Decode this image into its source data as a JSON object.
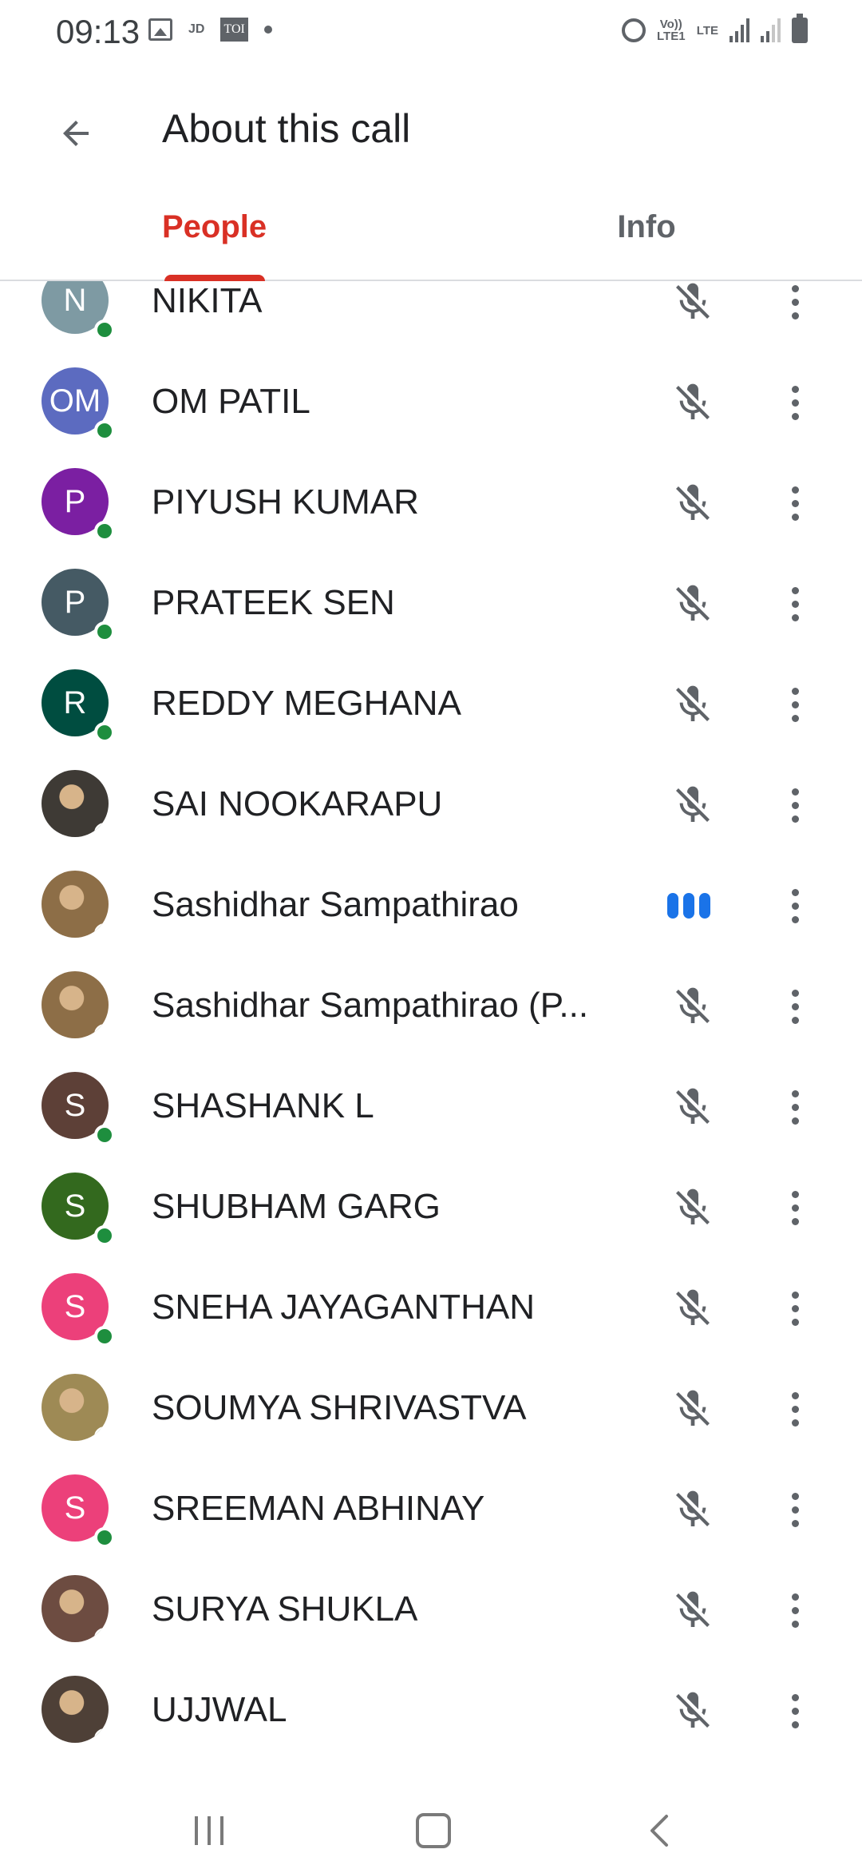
{
  "status_bar": {
    "time": "09:13",
    "left_icons": [
      "gallery-icon",
      "jd-icon",
      "toi-icon",
      "dot-icon"
    ],
    "jd_label": "JD",
    "toi_label": "TOI",
    "volte_label": "Vo)) LTE1",
    "lte_label": "LTE",
    "right_icons": [
      "alarm-icon",
      "volte-icon",
      "lte-icon",
      "signal-icon",
      "signal-icon",
      "battery-icon"
    ]
  },
  "header": {
    "title": "About this call",
    "back_icon": "arrow-back-icon"
  },
  "tabs": [
    {
      "label": "People",
      "active": true
    },
    {
      "label": "Info",
      "active": false
    }
  ],
  "colors": {
    "accent": "#d93025",
    "presence": "#1e8e3e",
    "speaking": "#1a73e8"
  },
  "participants": [
    {
      "name": "NIKITA",
      "initials": "N",
      "avatar_color": "#7e9aa3",
      "status": "muted"
    },
    {
      "name": "OM PATIL",
      "initials": "OM",
      "avatar_color": "#5c6bc0",
      "status": "muted"
    },
    {
      "name": "PIYUSH KUMAR",
      "initials": "P",
      "avatar_color": "#7b1fa2",
      "status": "muted"
    },
    {
      "name": "PRATEEK SEN",
      "initials": "P",
      "avatar_color": "#455a64",
      "status": "muted"
    },
    {
      "name": "REDDY MEGHANA",
      "initials": "R",
      "avatar_color": "#004d40",
      "status": "muted"
    },
    {
      "name": "SAI NOOKARAPU",
      "initials": "",
      "avatar_color": "#3e3a35",
      "status": "muted",
      "photo": true
    },
    {
      "name": "Sashidhar Sampathirao",
      "initials": "",
      "avatar_color": "#8d6e47",
      "status": "speaking",
      "photo": true
    },
    {
      "name": "Sashidhar Sampathirao (P...",
      "initials": "",
      "avatar_color": "#8d6e47",
      "status": "muted",
      "photo": true
    },
    {
      "name": "SHASHANK L",
      "initials": "S",
      "avatar_color": "#5d4037",
      "status": "muted"
    },
    {
      "name": "SHUBHAM GARG",
      "initials": "S",
      "avatar_color": "#33691e",
      "status": "muted"
    },
    {
      "name": "SNEHA JAYAGANTHAN",
      "initials": "S",
      "avatar_color": "#ec407a",
      "status": "muted"
    },
    {
      "name": "SOUMYA SHRIVASTVA",
      "initials": "",
      "avatar_color": "#9e8a55",
      "status": "muted",
      "photo": true
    },
    {
      "name": "SREEMAN ABHINAY",
      "initials": "S",
      "avatar_color": "#ec407a",
      "status": "muted"
    },
    {
      "name": "SURYA SHUKLA",
      "initials": "",
      "avatar_color": "#6d4c41",
      "status": "muted",
      "photo": true
    },
    {
      "name": "UJJWAL",
      "initials": "",
      "avatar_color": "#4e4037",
      "status": "muted",
      "photo": true
    }
  ],
  "nav_bar": {
    "icons": [
      "recents-icon",
      "home-icon",
      "back-icon"
    ]
  }
}
